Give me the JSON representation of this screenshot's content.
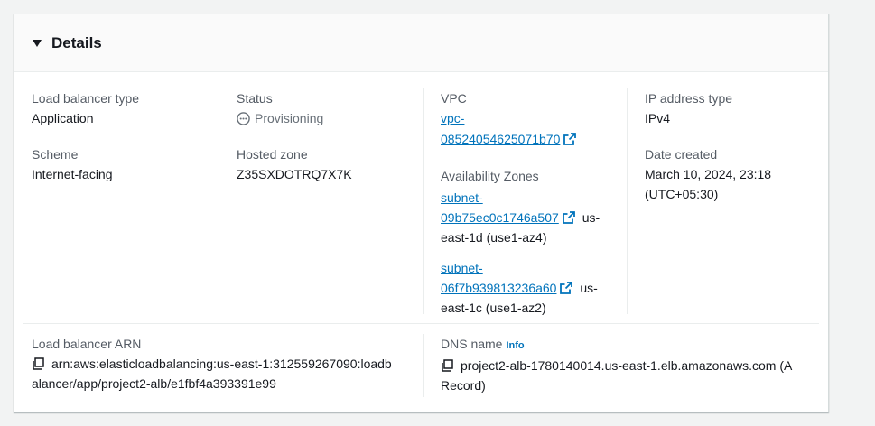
{
  "section": {
    "title": "Details",
    "caret_icon": "caret-down-icon"
  },
  "fields": {
    "load_balancer_type": {
      "label": "Load balancer type",
      "value": "Application"
    },
    "scheme": {
      "label": "Scheme",
      "value": "Internet-facing"
    },
    "status": {
      "label": "Status",
      "value": "Provisioning",
      "icon": "status-pending-icon"
    },
    "hosted_zone": {
      "label": "Hosted zone",
      "value": "Z35SXDOTRQ7X7K"
    },
    "vpc": {
      "label": "VPC",
      "link_line1": "vpc-",
      "link_line2": "08524054625071b70"
    },
    "availability_zones": {
      "label": "Availability Zones",
      "subnets": [
        {
          "line1": "subnet-",
          "line2": "09b75ec0c1746a507",
          "suffix1": "us-",
          "suffix2": "east-1d (use1-az4)"
        },
        {
          "line1": "subnet-",
          "line2": "06f7b939813236a60",
          "suffix1": "us-",
          "suffix2": "east-1c (use1-az2)"
        }
      ]
    },
    "ip_address_type": {
      "label": "IP address type",
      "value": "IPv4"
    },
    "date_created": {
      "label": "Date created",
      "value_line1": "March 10, 2024, 23:18",
      "value_line2": "(UTC+05:30)"
    },
    "arn": {
      "label": "Load balancer ARN",
      "value_line1": "arn:aws:elasticloadbalancing:us-east-1:312559267090:loadb",
      "value_line2": "alancer/app/project2-alb/e1fbf4a393391e99"
    },
    "dns_name": {
      "label": "DNS name",
      "info": "Info",
      "value_line1": "project2-alb-1780140014.us-east-1.elb.amazonaws.com (A",
      "value_line2": "Record)"
    }
  },
  "colors": {
    "link": "#0073bb",
    "muted_text": "#545b64",
    "status_pending": "#687078"
  }
}
